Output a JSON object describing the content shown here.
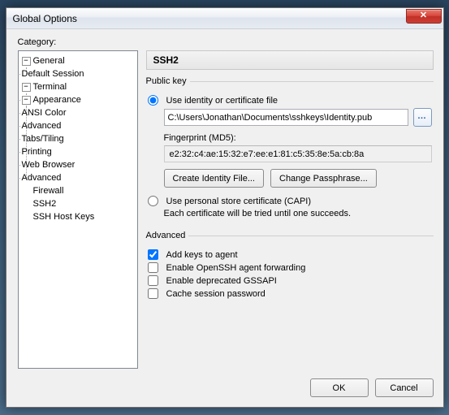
{
  "window": {
    "title": "Global Options"
  },
  "category_label": "Category:",
  "tree": {
    "general": "General",
    "default_session": "Default Session",
    "terminal": "Terminal",
    "appearance": "Appearance",
    "ansi_color": "ANSI Color",
    "advanced_appearance": "Advanced",
    "tabs_tiling": "Tabs/Tiling",
    "printing": "Printing",
    "web_browser": "Web Browser",
    "advanced_terminal": "Advanced",
    "firewall": "Firewall",
    "ssh2": "SSH2",
    "ssh_host_keys": "SSH Host Keys"
  },
  "panel": {
    "title": "SSH2",
    "publickey": {
      "legend": "Public key",
      "use_identity_label": "Use identity or certificate file",
      "path_value": "C:\\Users\\Jonathan\\Documents\\sshkeys\\Identity.pub",
      "fingerprint_label": "Fingerprint (MD5):",
      "fingerprint_value": "e2:32:c4:ae:15:32:e7:ee:e1:81:c5:35:8e:5a:cb:8a",
      "create_identity_btn": "Create Identity File...",
      "change_passphrase_btn": "Change Passphrase...",
      "use_capi_label": "Use personal store certificate (CAPI)",
      "capi_note": "Each certificate will be tried until one succeeds."
    },
    "advanced": {
      "legend": "Advanced",
      "add_keys": "Add keys to agent",
      "openssh_fwd": "Enable OpenSSH agent forwarding",
      "gssapi": "Enable deprecated GSSAPI",
      "cache_pw": "Cache session password"
    }
  },
  "footer": {
    "ok": "OK",
    "cancel": "Cancel"
  }
}
